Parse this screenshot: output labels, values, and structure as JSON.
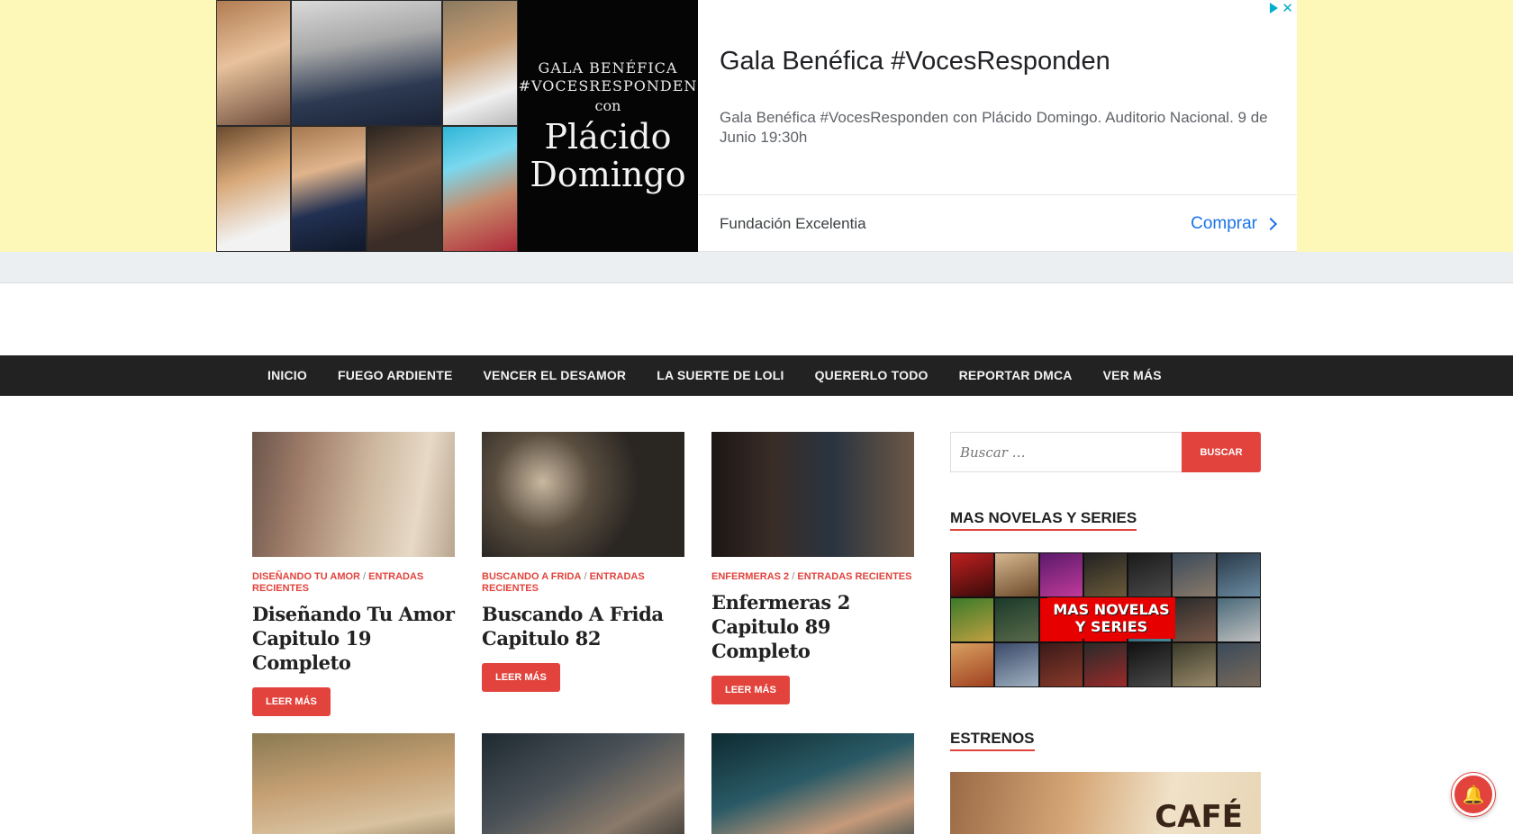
{
  "ad": {
    "poster_line1": "GALA BENÉFICA",
    "poster_line2": "#VOCESRESPONDEN",
    "poster_con": "con",
    "poster_name1": "Plácido",
    "poster_name2": "Domingo",
    "title": "Gala Benéfica #VocesResponden",
    "description": "Gala Benéfica #VocesResponden con Plácido Domingo. Auditorio Nacional. 9 de Junio 19:30h",
    "advertiser": "Fundación Excelentia",
    "cta": "Comprar",
    "close_glyph": "✕",
    "adchoices_icon": "adchoices-icon",
    "accent_color": "#1a73e8"
  },
  "nav": {
    "items": [
      "INICIO",
      "FUEGO ARDIENTE",
      "VENCER EL DESAMOR",
      "LA SUERTE DE LOLI",
      "QUERERLO TODO",
      "REPORTAR DMCA",
      "VER MÁS"
    ]
  },
  "posts": [
    {
      "cat1": "DISEÑANDO TU AMOR",
      "cat2": "ENTRADAS RECIENTES",
      "title": "Diseñando Tu Amor Capitulo 19 Completo",
      "button": "LEER MÁS"
    },
    {
      "cat1": "BUSCANDO A FRIDA",
      "cat2": "ENTRADAS RECIENTES",
      "title": "Buscando A Frida Capitulo 82",
      "button": "LEER MÁS"
    },
    {
      "cat1": "ENFERMERAS 2",
      "cat2": "ENTRADAS RECIENTES",
      "title": "Enfermeras 2 Capitulo 89 Completo",
      "button": "LEER MÁS"
    }
  ],
  "sidebar": {
    "search_placeholder": "Buscar …",
    "search_button": "BUSCAR",
    "widget1_title": "MAS NOVELAS Y SERIES",
    "promo_label": "MAS NOVELAS Y SERIES",
    "widget2_title": "ESTRENOS",
    "estrenos_word": "CAFÉ"
  },
  "colors": {
    "accent": "#e2433c",
    "nav_bg": "#222222",
    "ad_bg": "#fdf8b8"
  },
  "notification": {
    "icon": "bell-icon",
    "glyph": "🔔"
  }
}
